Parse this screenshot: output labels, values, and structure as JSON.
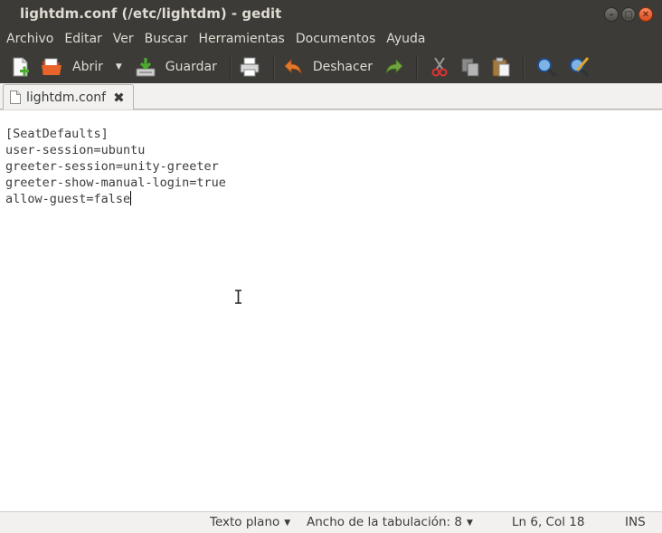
{
  "window": {
    "title": "lightdm.conf (/etc/lightdm) - gedit",
    "controls": {
      "minimize": "–",
      "maximize": "□",
      "close": "✕"
    }
  },
  "menubar": [
    "Archivo",
    "Editar",
    "Ver",
    "Buscar",
    "Herramientas",
    "Documentos",
    "Ayuda"
  ],
  "toolbar": {
    "open_label": "Abrir",
    "save_label": "Guardar",
    "undo_label": "Deshacer"
  },
  "tab": {
    "label": "lightdm.conf",
    "close": "✖"
  },
  "editor": {
    "lines": [
      "[SeatDefaults]",
      "user-session=ubuntu",
      "greeter-session=unity-greeter",
      "greeter-show-manual-login=true",
      "allow-guest=false"
    ]
  },
  "statusbar": {
    "syntax": "Texto plano",
    "tab_width": "Ancho de la tabulación:  8",
    "position": "Ln 6, Col 18",
    "mode": "INS"
  },
  "colors": {
    "chrome_dark": "#3c3b37",
    "chrome_light": "#f2f1f0",
    "close_button": "#e0531f",
    "open_icon": "#e05f1e",
    "undo_icon": "#e07b1e",
    "redo_icon": "#6aa13a",
    "find_icon": "#1d5aa8"
  }
}
